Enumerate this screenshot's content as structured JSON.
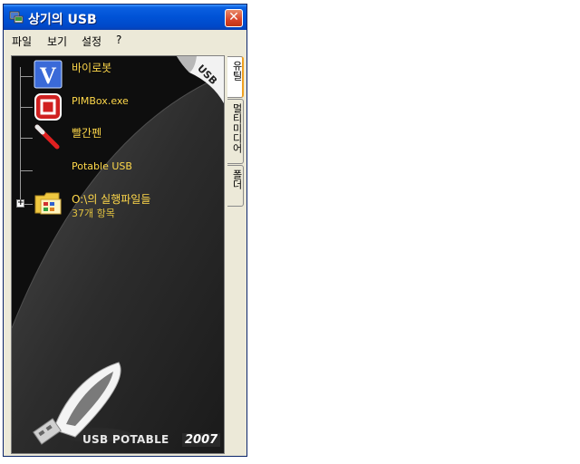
{
  "window": {
    "title": "상기의 USB",
    "close_label": "✕"
  },
  "menu": [
    "파일",
    "보기",
    "설정",
    "?"
  ],
  "tree": {
    "items": [
      {
        "label": "바이로봇",
        "icon": "vrobot-icon"
      },
      {
        "label": "PIMBox.exe",
        "icon": "pimbox-icon"
      },
      {
        "label": "빨간펜",
        "icon": "red-pen-icon"
      },
      {
        "label": "Potable USB",
        "icon": ""
      },
      {
        "label": "O:\\의 실행파일들",
        "sub": "37개 항목",
        "icon": "folder-apps-icon",
        "expander": "+"
      }
    ]
  },
  "badge": "USB",
  "brand": {
    "text": "USB POTABLE",
    "year": "2007"
  },
  "tabs": [
    "유틸",
    "멀티미디어",
    "폴더"
  ],
  "colors": {
    "title_bar": "#0052d6",
    "panel": "#101010",
    "label": "#ffd84a"
  }
}
